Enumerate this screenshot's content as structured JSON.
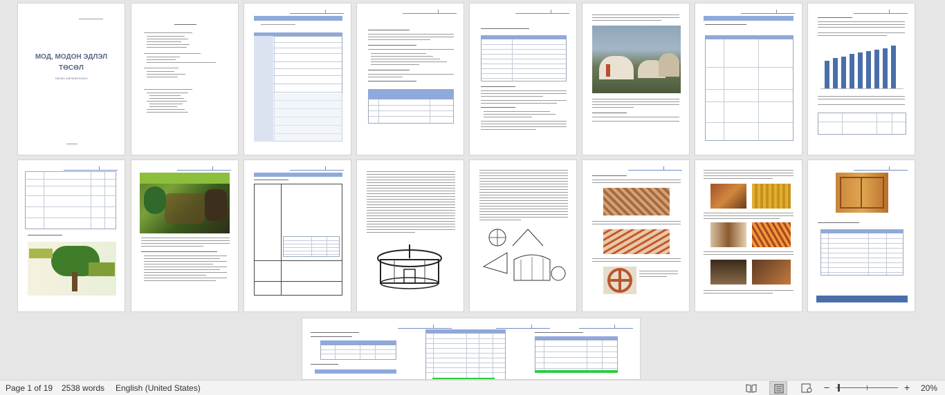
{
  "document": {
    "cover_title_line1": "МОД, МОДОН ЭДЛЭЛ",
    "cover_title_line2": "ТӨСӨЛ",
    "cover_subtitle": "ТӨСӨЛ ХЭРЭГЖҮҮЛЭГЧ"
  },
  "status_bar": {
    "page_info": "Page 1 of 19",
    "word_count": "2538 words",
    "language": "English (United States)",
    "zoom_level": "20%",
    "zoom_out_label": "−",
    "zoom_in_label": "+"
  },
  "icons": {
    "read_mode": "read-mode-icon",
    "print_layout": "print-layout-icon",
    "web_layout": "web-layout-icon"
  },
  "colors": {
    "accent_blue": "#4a6ea9",
    "table_header": "#8ea9db",
    "background": "#e6e6e6",
    "status_bar": "#f3f3f3"
  }
}
